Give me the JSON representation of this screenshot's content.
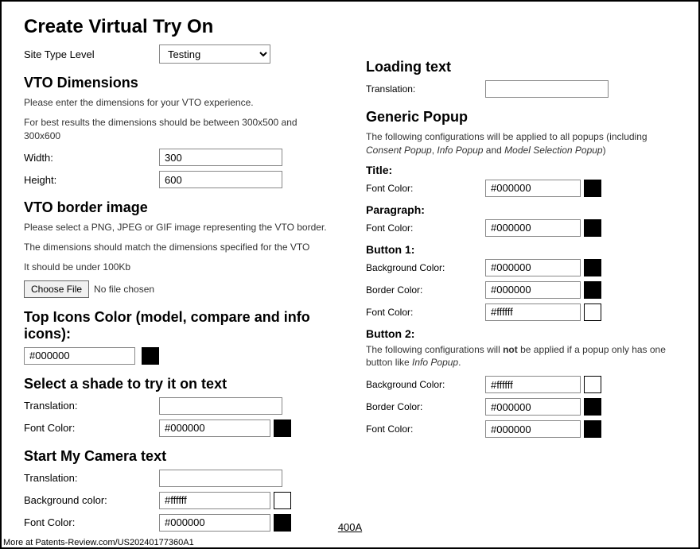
{
  "title": "Create Virtual Try On",
  "siteLevel": {
    "label": "Site Type Level",
    "value": "Testing"
  },
  "dims": {
    "heading": "VTO Dimensions",
    "help1": "Please enter the dimensions for your VTO experience.",
    "help2": "For best results the dimensions should be between 300x500 and 300x600",
    "widthLabel": "Width:",
    "widthValue": "300",
    "heightLabel": "Height:",
    "heightValue": "600"
  },
  "border": {
    "heading": "VTO border image",
    "help1": "Please select a PNG, JPEG or GIF image representing the VTO border.",
    "help2": "The dimensions should match the dimensions specified for the VTO",
    "help3": "It should be under 100Kb",
    "chooseLabel": "Choose File",
    "fileStatus": "No file chosen"
  },
  "topIcons": {
    "heading": "Top Icons Color (model, compare and info icons):",
    "value": "#000000"
  },
  "shadeText": {
    "heading": "Select a shade to try it on text",
    "translationLabel": "Translation:",
    "translationValue": "",
    "fontColorLabel": "Font Color:",
    "fontColorValue": "#000000"
  },
  "cameraText": {
    "heading": "Start My Camera text",
    "translationLabel": "Translation:",
    "translationValue": "",
    "bgLabel": "Background color:",
    "bgValue": "#ffffff",
    "fcLabel": "Font Color:",
    "fcValue": "#000000"
  },
  "loadingText": {
    "heading": "Loading text",
    "translationLabel": "Translation:",
    "translationValue": ""
  },
  "popup": {
    "heading": "Generic Popup",
    "help": "The following configurations will be applied to all popups (including Consent Popup, Info Popup and Model Selection Popup)",
    "titleHeading": "Title:",
    "titleFcLabel": "Font Color:",
    "titleFcValue": "#000000",
    "paraHeading": "Paragraph:",
    "paraFcLabel": "Font Color:",
    "paraFcValue": "#000000",
    "btn1Heading": "Button 1:",
    "btn1BgLabel": "Background Color:",
    "btn1BgValue": "#000000",
    "btn1BorderLabel": "Border Color:",
    "btn1BorderValue": "#000000",
    "btn1FcLabel": "Font Color:",
    "btn1FcValue": "#ffffff",
    "btn2Heading": "Button 2:",
    "btn2Help": "The following configurations will not be applied if a popup only has one button like Info Popup.",
    "btn2BgLabel": "Background Color:",
    "btn2BgValue": "#ffffff",
    "btn2BorderLabel": "Border Color:",
    "btn2BorderValue": "#000000",
    "btn2FcLabel": "Font Color:",
    "btn2FcValue": "#000000"
  },
  "figureLabel": "400A",
  "footer": "More at Patents-Review.com/US20240177360A1"
}
